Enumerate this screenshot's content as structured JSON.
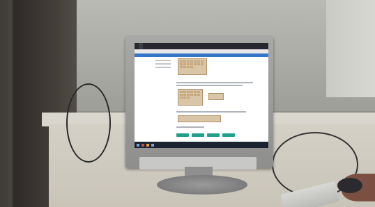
{
  "scene": {
    "description_keys": [
      "wall",
      "door",
      "desk",
      "monitor",
      "keyboard",
      "mouse",
      "hand"
    ]
  },
  "browser": {
    "tabs": [
      {
        "label": ""
      },
      {
        "label": ""
      },
      {
        "label": ""
      }
    ],
    "url": ""
  },
  "colors": {
    "app_header": "#3477c8",
    "buttons": "#1fa08a",
    "puzzle": "#d9c6a6",
    "taskbar": "#1c2330"
  }
}
